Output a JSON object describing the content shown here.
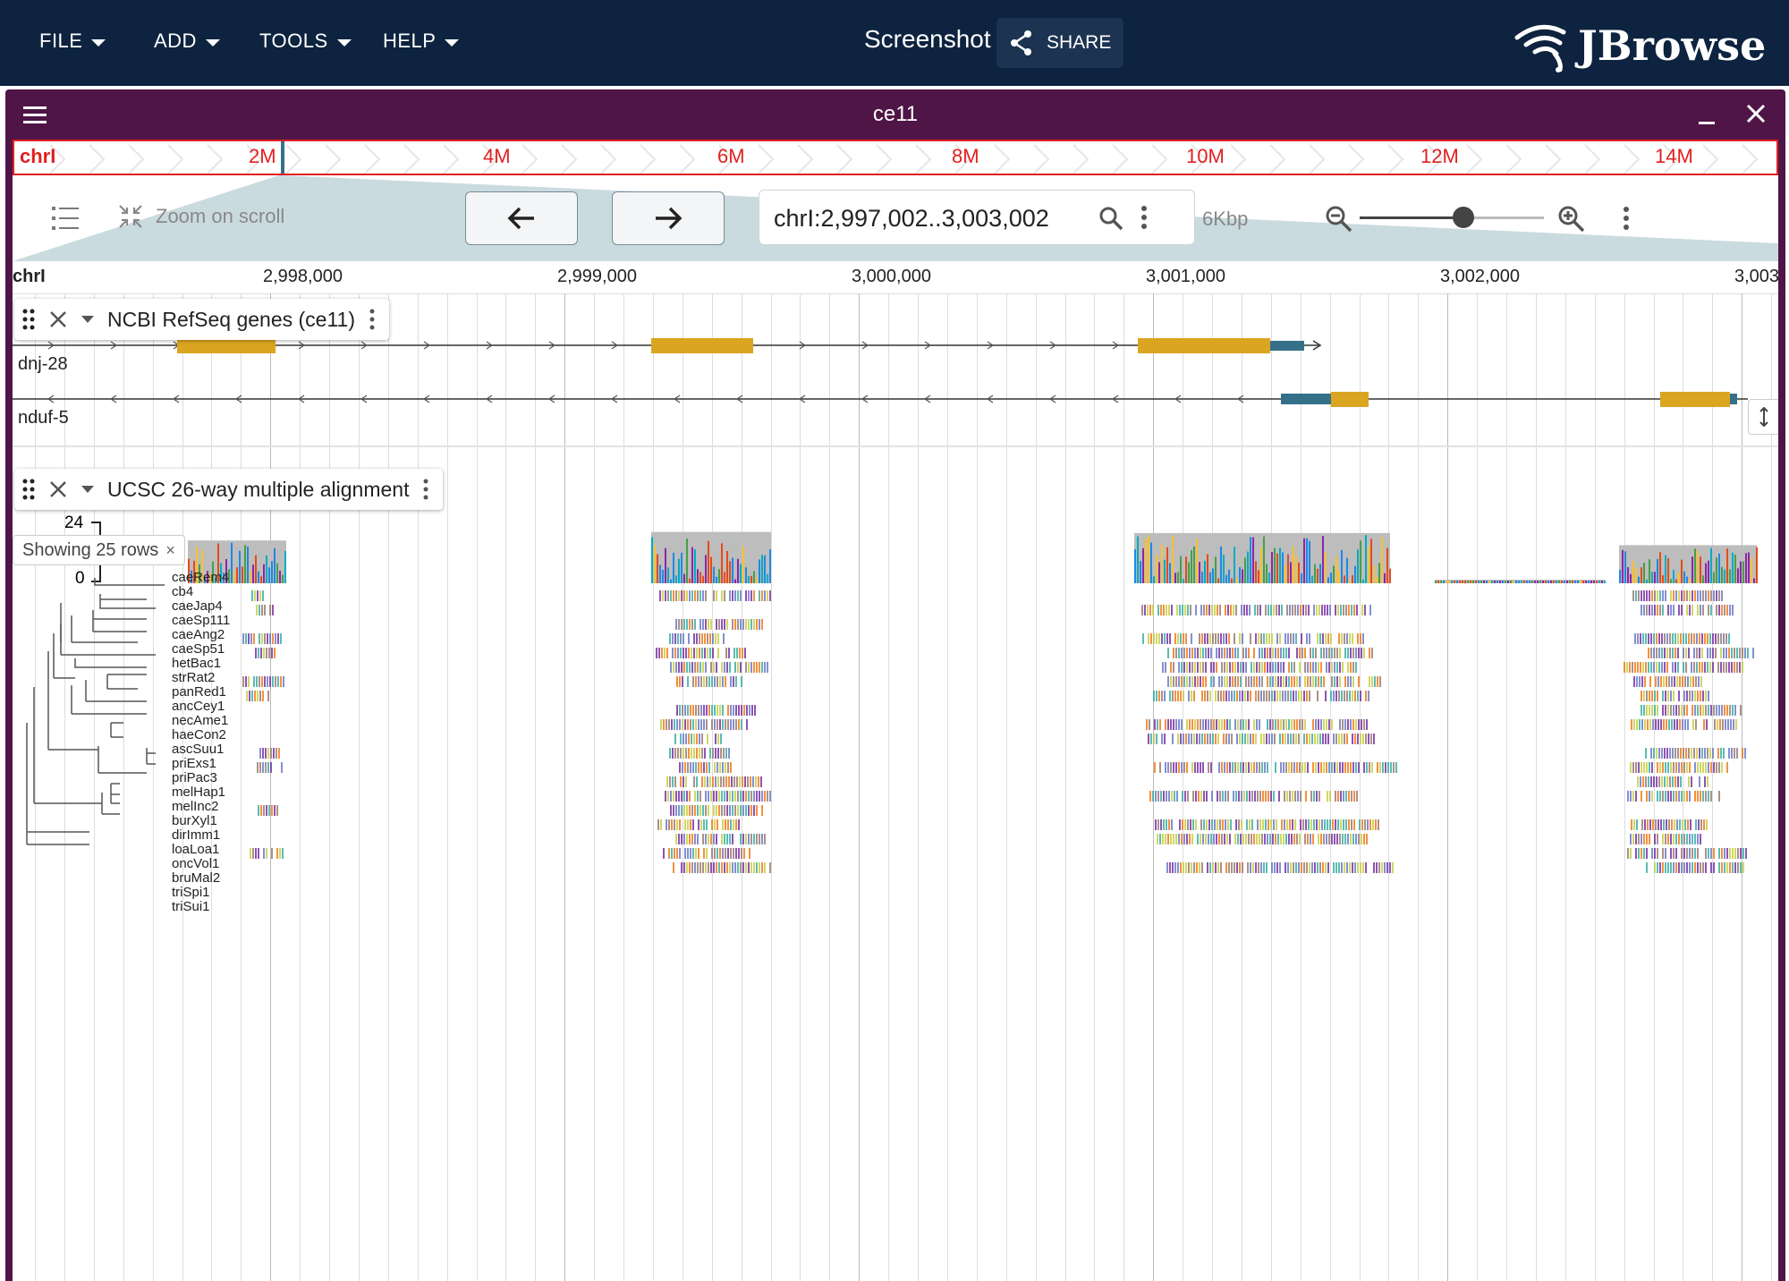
{
  "app": {
    "menu": [
      "FILE",
      "ADD",
      "TOOLS",
      "HELP"
    ],
    "session_name": "Screenshot",
    "share_label": "SHARE",
    "logo_text": "JBrowse"
  },
  "view": {
    "title": "ce11",
    "assembly_chrom": "chrI"
  },
  "overview": {
    "chrom": "chrI",
    "labels": [
      "2M",
      "4M",
      "6M",
      "8M",
      "10M",
      "12M",
      "14M"
    ]
  },
  "controls": {
    "zoom_on_scroll": "Zoom on scroll",
    "locstring": "chrI:2,997,002..3,003,002",
    "bp_per_view": "6Kbp"
  },
  "ruler": {
    "chrom": "chrI",
    "labels": [
      "2,998,000",
      "2,999,000",
      "3,000,000",
      "3,001,000",
      "3,002,000",
      "3,003"
    ]
  },
  "tracks": {
    "genes": {
      "title": "NCBI RefSeq genes (ce11)",
      "features": [
        "dnj-28",
        "nduf-5"
      ]
    },
    "alignment": {
      "title": "UCSC 26-way multiple alignment",
      "ymax": "24",
      "ymin": "0",
      "rows_chip": "Showing 25 rows",
      "species": [
        "caeRem4",
        "cb4",
        "caeJap4",
        "caeSp111",
        "caeAng2",
        "caeSp51",
        "hetBac1",
        "strRat2",
        "panRed1",
        "ancCey1",
        "necAme1",
        "haeCon2",
        "ascSuu1",
        "priExs1",
        "priPac3",
        "melHap1",
        "melInc2",
        "burXyl1",
        "dirImm1",
        "loaLoa1",
        "oncVol1",
        "bruMal2",
        "triSpi1",
        "triSui1"
      ]
    }
  },
  "colors": {
    "topbar": "#0d233f",
    "view_header": "#4f1546",
    "overview_red": "#e02020",
    "cds": "#daa520",
    "utr": "#357089"
  }
}
